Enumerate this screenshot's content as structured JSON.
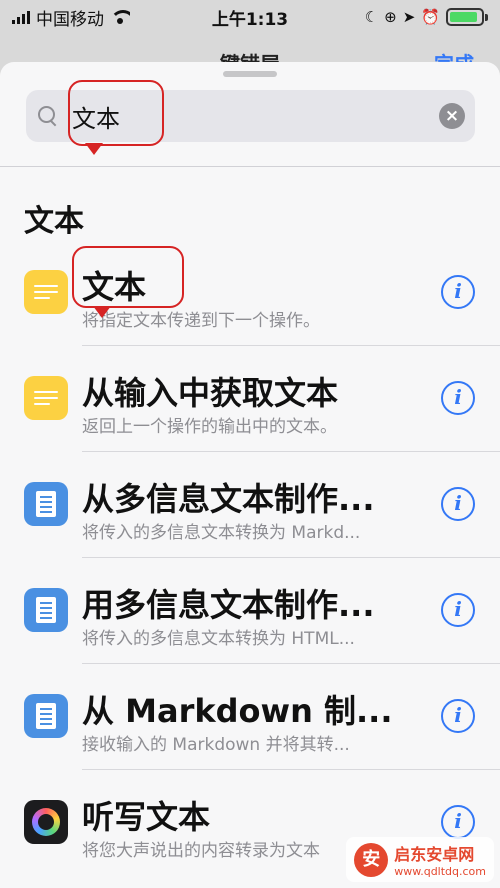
{
  "status_bar": {
    "carrier": "中国移动",
    "time": "上午1:13",
    "battery_level": 0.9,
    "battery_color": "#4cd964"
  },
  "background_nav": {
    "title": "键错屋",
    "done_label": "完成"
  },
  "search": {
    "value": "文本",
    "placeholder": "",
    "icon": "search-icon",
    "clear_icon": "clear-icon"
  },
  "section": {
    "title": "文本"
  },
  "actions": [
    {
      "title": "文本",
      "subtitle": "将指定文本传递到下一个操作。",
      "icon": "text-icon",
      "icon_color": "#fcd142"
    },
    {
      "title": "从输入中获取文本",
      "subtitle": "返回上一个操作的输出中的文本。",
      "icon": "text-icon",
      "icon_color": "#fcd142"
    },
    {
      "title": "从多信息文本制作...",
      "subtitle": "将传入的多信息文本转换为 Markd...",
      "icon": "document-icon",
      "icon_color": "#4a90e2"
    },
    {
      "title": "用多信息文本制作...",
      "subtitle": "将传入的多信息文本转换为 HTML...",
      "icon": "document-icon",
      "icon_color": "#4a90e2"
    },
    {
      "title": "从 Markdown 制...",
      "subtitle": "接收输入的 Markdown 并将其转...",
      "icon": "document-icon",
      "icon_color": "#4a90e2"
    },
    {
      "title": "听写文本",
      "subtitle": "将您大声说出的内容转录为文本",
      "icon": "dictation-icon",
      "icon_color": "#1c1c1e"
    }
  ],
  "info_label": "i",
  "watermark": {
    "name": "启东安卓网",
    "url": "www.qdltdq.com"
  },
  "accent_color": "#3478f6",
  "annotation_color": "#d62424"
}
